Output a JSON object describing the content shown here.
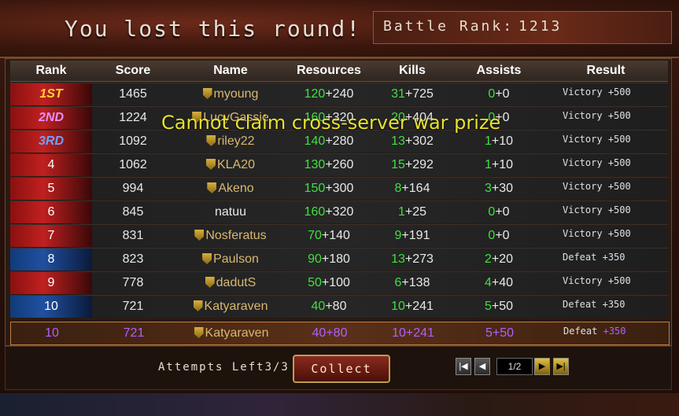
{
  "header": {
    "title": "You lost this round!",
    "battle_rank_label": "Battle Rank:",
    "battle_rank_value": "1213"
  },
  "columns": [
    "Rank",
    "Score",
    "Name",
    "Resources",
    "Kills",
    "Assists",
    "Result"
  ],
  "rows": [
    {
      "rank": "1ST",
      "score": "1465",
      "name": "myoung",
      "res_a": "120",
      "res_b": "+240",
      "kills_a": "31",
      "kills_b": "+725",
      "as_a": "0",
      "as_b": "+0",
      "result": "Victory",
      "bonus": "+500"
    },
    {
      "rank": "2ND",
      "score": "1224",
      "name": "LucyGassie",
      "res_a": "160",
      "res_b": "+320",
      "kills_a": "20",
      "kills_b": "+404",
      "as_a": "0",
      "as_b": "+0",
      "result": "Victory",
      "bonus": "+500"
    },
    {
      "rank": "3RD",
      "score": "1092",
      "name": "riley22",
      "res_a": "140",
      "res_b": "+280",
      "kills_a": "13",
      "kills_b": "+302",
      "as_a": "1",
      "as_b": "+10",
      "result": "Victory",
      "bonus": "+500"
    },
    {
      "rank": "4",
      "score": "1062",
      "name": "KLA20",
      "res_a": "130",
      "res_b": "+260",
      "kills_a": "15",
      "kills_b": "+292",
      "as_a": "1",
      "as_b": "+10",
      "result": "Victory",
      "bonus": "+500"
    },
    {
      "rank": "5",
      "score": "994",
      "name": "Akeno",
      "res_a": "150",
      "res_b": "+300",
      "kills_a": "8",
      "kills_b": "+164",
      "as_a": "3",
      "as_b": "+30",
      "result": "Victory",
      "bonus": "+500"
    },
    {
      "rank": "6",
      "score": "845",
      "name": "natuu",
      "res_a": "160",
      "res_b": "+320",
      "kills_a": "1",
      "kills_b": "+25",
      "as_a": "0",
      "as_b": "+0",
      "result": "Victory",
      "bonus": "+500"
    },
    {
      "rank": "7",
      "score": "831",
      "name": "Nosferatus",
      "res_a": "70",
      "res_b": "+140",
      "kills_a": "9",
      "kills_b": "+191",
      "as_a": "0",
      "as_b": "+0",
      "result": "Victory",
      "bonus": "+500"
    },
    {
      "rank": "8",
      "score": "823",
      "name": "Paulson",
      "res_a": "90",
      "res_b": "+180",
      "kills_a": "13",
      "kills_b": "+273",
      "as_a": "2",
      "as_b": "+20",
      "result": "Defeat",
      "bonus": "+350"
    },
    {
      "rank": "9",
      "score": "778",
      "name": "dadutS",
      "res_a": "50",
      "res_b": "+100",
      "kills_a": "6",
      "kills_b": "+138",
      "as_a": "4",
      "as_b": "+40",
      "result": "Victory",
      "bonus": "+500"
    },
    {
      "rank": "10",
      "score": "721",
      "name": "Katyaraven",
      "res_a": "40",
      "res_b": "+80",
      "kills_a": "10",
      "kills_b": "+241",
      "as_a": "5",
      "as_b": "+50",
      "result": "Defeat",
      "bonus": "+350"
    }
  ],
  "self_row": {
    "rank": "10",
    "score": "721",
    "name": "Katyaraven",
    "res": "40+80",
    "kills": "10+241",
    "assists": "5+50",
    "result": "Defeat",
    "bonus": "+350"
  },
  "toast": "Cannot claim cross-server war prize",
  "footer": {
    "attempts_label": "Attempts Left",
    "attempts_value": "3/3",
    "collect_label": "Collect",
    "page": "1/2"
  },
  "icons": {
    "first": "first-page-icon",
    "prev": "prev-page-icon",
    "next": "next-page-icon",
    "last": "last-page-icon",
    "guild": "shield-icon"
  }
}
